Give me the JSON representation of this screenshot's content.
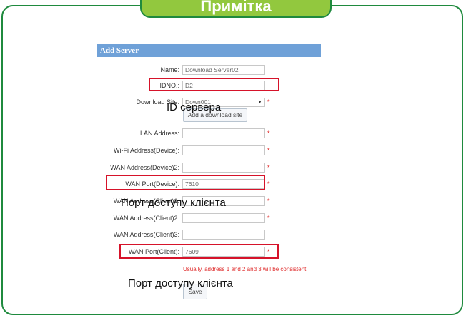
{
  "banner": {
    "title": "Примітка"
  },
  "form": {
    "header": "Add Server",
    "fields": {
      "name": {
        "label": "Name:",
        "value": "Download Server02"
      },
      "idno": {
        "label": "IDNO.:",
        "value": "D2"
      },
      "download_site": {
        "label": "Download Site:",
        "value": "Down001",
        "required_mark": "*"
      },
      "lan_address": {
        "label": "LAN Address:",
        "value": "",
        "required_mark": "*"
      },
      "wifi_address_device": {
        "label": "Wi-Fi Address(Device):",
        "value": "",
        "required_mark": "*"
      },
      "wan_address_device2": {
        "label": "WAN Address(Device)2:",
        "value": "",
        "required_mark": "*"
      },
      "wan_port_device": {
        "label": "WAN Port(Device):",
        "value": "7610",
        "required_mark": "*"
      },
      "wan_address_client1": {
        "label": "WAN Address(Client)1:",
        "value": "",
        "required_mark": "*"
      },
      "wan_address_client2": {
        "label": "WAN Address(Client)2:",
        "value": "",
        "required_mark": "*"
      },
      "wan_address_client3": {
        "label": "WAN Address(Client)3:",
        "value": ""
      },
      "wan_port_client": {
        "label": "WAN Port(Client):",
        "value": "7609",
        "required_mark": "*"
      }
    },
    "add_site_button": "Add a download site",
    "note": "Usually, address 1 and 2 and 3 will be consistent!",
    "save_button": "Save"
  },
  "callouts": {
    "server_id": "ID сервера",
    "client_port_1": "Порт доступу клієнта",
    "client_port_2": "Порт доступу клієнта"
  },
  "colors": {
    "frame": "#1f8a3e",
    "banner": "#92c83e",
    "header": "#6fa1d8",
    "highlight": "#d6132a",
    "warning_text": "#e03030"
  }
}
